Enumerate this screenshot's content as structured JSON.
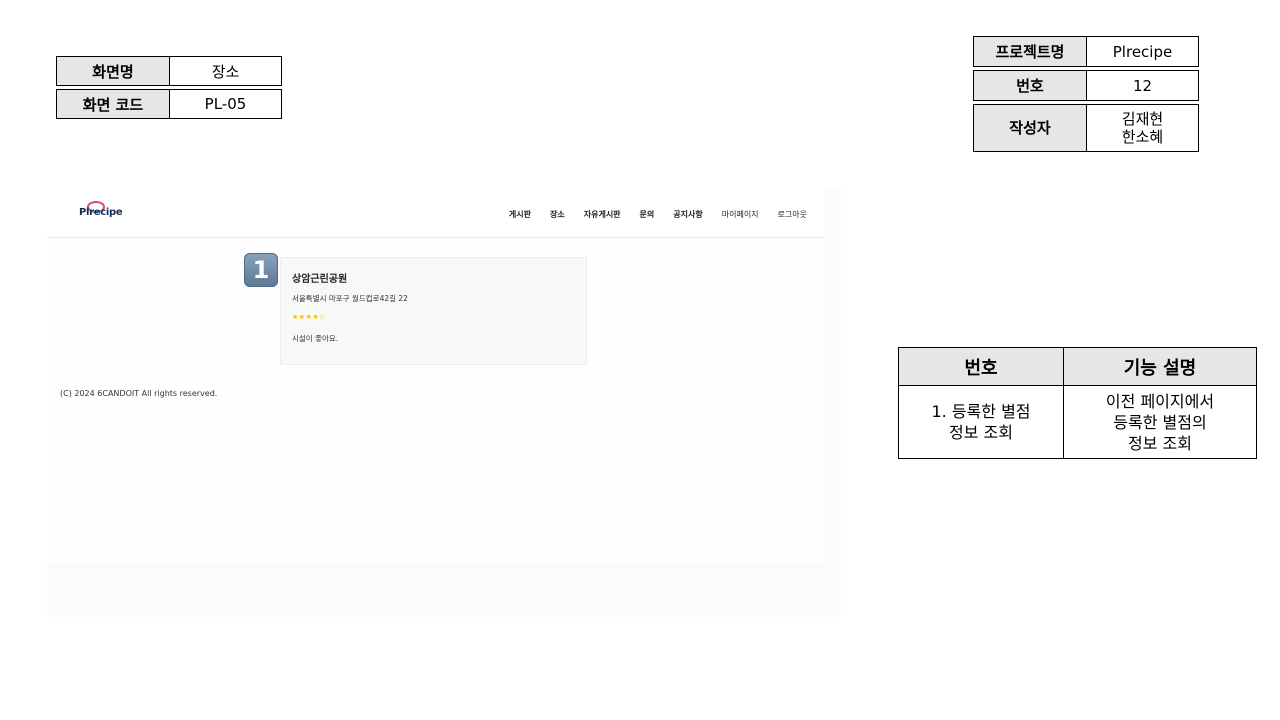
{
  "screen_info": {
    "name_label": "화면명",
    "name_value": "장소",
    "code_label": "화면 코드",
    "code_value": "PL-05"
  },
  "project_info": {
    "project_label": "프로젝트명",
    "project_value": "Plrecipe",
    "number_label": "번호",
    "number_value": "12",
    "author_label": "작성자",
    "author_line1": "김재현",
    "author_line2": "한소혜"
  },
  "function_table": {
    "col_number": "번호",
    "col_desc": "기능 설명",
    "rows": [
      {
        "number_line1": "1. 등록한 별점",
        "number_line2": "정보 조회",
        "desc_line1": "이전 페이지에서",
        "desc_line2": "등록한 별점의",
        "desc_line3": "정보 조회"
      }
    ]
  },
  "screenshot": {
    "logo": "Plrecipe",
    "menu": [
      "게시판",
      "장소",
      "자유게시판",
      "문의",
      "공지사항",
      "마이페이지",
      "로그아웃"
    ],
    "card": {
      "place_name": "상암근린공원",
      "address": "서울특별시 마포구 월드컵로42길 22",
      "stars": "★★★★☆",
      "review": "시설이 좋아요."
    },
    "footer": "(C) 2024 6CANDOIT All rights reserved."
  },
  "badge": "1"
}
